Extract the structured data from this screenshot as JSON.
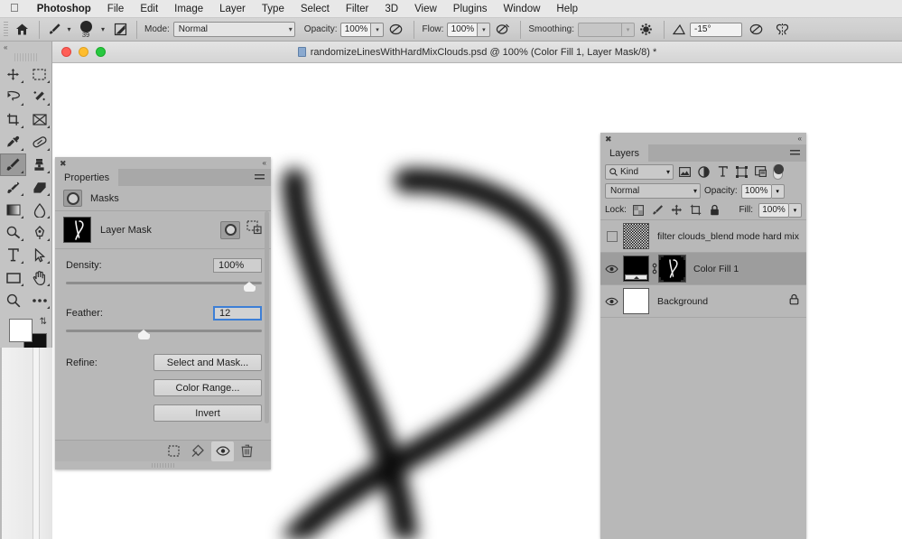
{
  "menubar": {
    "apple": "apple-logo",
    "items": [
      {
        "label": "Photoshop",
        "bold": true
      },
      {
        "label": "File"
      },
      {
        "label": "Edit"
      },
      {
        "label": "Image"
      },
      {
        "label": "Layer"
      },
      {
        "label": "Type"
      },
      {
        "label": "Select"
      },
      {
        "label": "Filter"
      },
      {
        "label": "3D"
      },
      {
        "label": "View"
      },
      {
        "label": "Plugins"
      },
      {
        "label": "Window"
      },
      {
        "label": "Help"
      }
    ]
  },
  "options_bar": {
    "home_icon": "home-icon",
    "brush_preset_icon": "brush-icon",
    "brush_size": "39",
    "brush_panel_icon": "brush-settings-icon",
    "mode_label": "Mode:",
    "mode_value": "Normal",
    "opacity_label": "Opacity:",
    "opacity_value": "100%",
    "opacity_pressure_icon": "pressure-opacity-icon",
    "flow_label": "Flow:",
    "flow_value": "100%",
    "airbrush_icon": "airbrush-icon",
    "smoothing_label": "Smoothing:",
    "smoothing_value": "",
    "smoothing_options_icon": "gear-icon",
    "angle_icon": "angle-icon",
    "angle_value": "-15°",
    "pressure_size_icon": "pressure-size-icon",
    "symmetry_icon": "symmetry-butterfly-icon"
  },
  "toolbar": {
    "collapse_icon": "collapse-icon",
    "tools": [
      {
        "name": "move-tool",
        "glyph": "move"
      },
      {
        "name": "rectangular-marquee-tool",
        "glyph": "marquee"
      },
      {
        "name": "lasso-tool",
        "glyph": "lasso"
      },
      {
        "name": "object-selection-tool",
        "glyph": "magicwand"
      },
      {
        "name": "crop-tool",
        "glyph": "crop"
      },
      {
        "name": "frame-tool",
        "glyph": "frame"
      },
      {
        "name": "eyedropper-tool",
        "glyph": "eyedropper"
      },
      {
        "name": "healing-brush-tool",
        "glyph": "bandaid"
      },
      {
        "name": "brush-tool",
        "glyph": "brush",
        "selected": true
      },
      {
        "name": "clone-stamp-tool",
        "glyph": "stamp"
      },
      {
        "name": "history-brush-tool",
        "glyph": "historybrush"
      },
      {
        "name": "eraser-tool",
        "glyph": "eraser"
      },
      {
        "name": "gradient-tool",
        "glyph": "gradient"
      },
      {
        "name": "blur-tool",
        "glyph": "blur"
      },
      {
        "name": "dodge-tool",
        "glyph": "dodge"
      },
      {
        "name": "pen-tool",
        "glyph": "pen"
      },
      {
        "name": "type-tool",
        "glyph": "type"
      },
      {
        "name": "path-selection-tool",
        "glyph": "arrow"
      },
      {
        "name": "rectangle-tool",
        "glyph": "rectangle"
      },
      {
        "name": "hand-tool",
        "glyph": "hand"
      },
      {
        "name": "zoom-tool",
        "glyph": "zoom"
      },
      {
        "name": "edit-toolbar-tool",
        "glyph": "ellipsis"
      }
    ],
    "foreground_color": "#ffffff",
    "background_color": "#111111",
    "swap_icon": "swap-colors-icon",
    "default_colors_icon": "default-colors-icon",
    "quick_mask_icon": "quick-mask-icon",
    "screen_mode_icon": "screen-mode-icon"
  },
  "document": {
    "title": "randomizeLinesWithHardMixClouds.psd @ 100% (Color Fill 1, Layer Mask/8) *",
    "file_icon": "psd-file-icon",
    "close_button": "close-button",
    "minimize_button": "minimize-button",
    "zoom_button": "zoom-button",
    "zoom_level": "100%",
    "canvas_background": "#ffffff",
    "stroke_color": "#0a0a0a"
  },
  "properties_panel": {
    "close_icon": "close-icon",
    "collapse_icon": "collapse-icon",
    "tab_label": "Properties",
    "menu_icon": "panel-menu-icon",
    "section_label": "Masks",
    "section_icon": "masks-icon",
    "mask_row_label": "Layer Mask",
    "mask_thumbnail": "layer-mask-thumbnail",
    "pixel_mask_button": "add-pixel-mask-icon",
    "vector_mask_button": "add-vector-mask-icon",
    "density_label": "Density:",
    "density_value": "100%",
    "feather_label": "Feather:",
    "feather_value": "12",
    "refine_label": "Refine:",
    "buttons": [
      {
        "name": "select-and-mask-button",
        "label": "Select and Mask..."
      },
      {
        "name": "color-range-button",
        "label": "Color Range..."
      },
      {
        "name": "invert-button",
        "label": "Invert"
      }
    ],
    "footer_icons": [
      {
        "name": "load-selection-from-mask-icon",
        "active": false
      },
      {
        "name": "apply-mask-icon",
        "active": false
      },
      {
        "name": "toggle-mask-visibility-icon",
        "active": true
      },
      {
        "name": "delete-mask-icon",
        "active": false
      }
    ]
  },
  "layers_panel": {
    "close_icon": "close-icon",
    "collapse_icon": "collapse-icon",
    "tab_label": "Layers",
    "menu_icon": "panel-menu-icon",
    "filter_kind_label": "Kind",
    "filter_search_icon": "search-icon",
    "filter_icons": [
      {
        "name": "filter-pixel-layers-icon"
      },
      {
        "name": "filter-adjustment-layers-icon"
      },
      {
        "name": "filter-type-layers-icon"
      },
      {
        "name": "filter-shape-layers-icon"
      },
      {
        "name": "filter-smart-object-layers-icon"
      }
    ],
    "filter_toggle": "filter-enable-toggle",
    "blend_mode": "Normal",
    "opacity_label": "Opacity:",
    "opacity_value": "100%",
    "lock_label": "Lock:",
    "lock_icons": [
      {
        "name": "lock-transparent-pixels-icon"
      },
      {
        "name": "lock-image-pixels-icon"
      },
      {
        "name": "lock-position-icon"
      },
      {
        "name": "lock-artboard-nesting-icon"
      },
      {
        "name": "lock-all-icon"
      }
    ],
    "fill_label": "Fill:",
    "fill_value": "100%",
    "layers": [
      {
        "name": "filter clouds_blend mode hard mix",
        "visible": false,
        "thumb": "clouds-noise-thumbnail",
        "selected": false,
        "locked": false,
        "has_mask": false
      },
      {
        "name": "Color Fill 1",
        "visible": true,
        "thumb": "solid-color-fill-thumbnail",
        "selected": true,
        "locked": false,
        "has_mask": true,
        "link_icon": "link-mask-icon",
        "mask_thumb": "layer-mask-thumbnail"
      },
      {
        "name": "Background",
        "visible": true,
        "thumb": "background-white-thumbnail",
        "selected": false,
        "locked": true,
        "lock_icon": "lock-icon",
        "has_mask": false
      }
    ]
  }
}
